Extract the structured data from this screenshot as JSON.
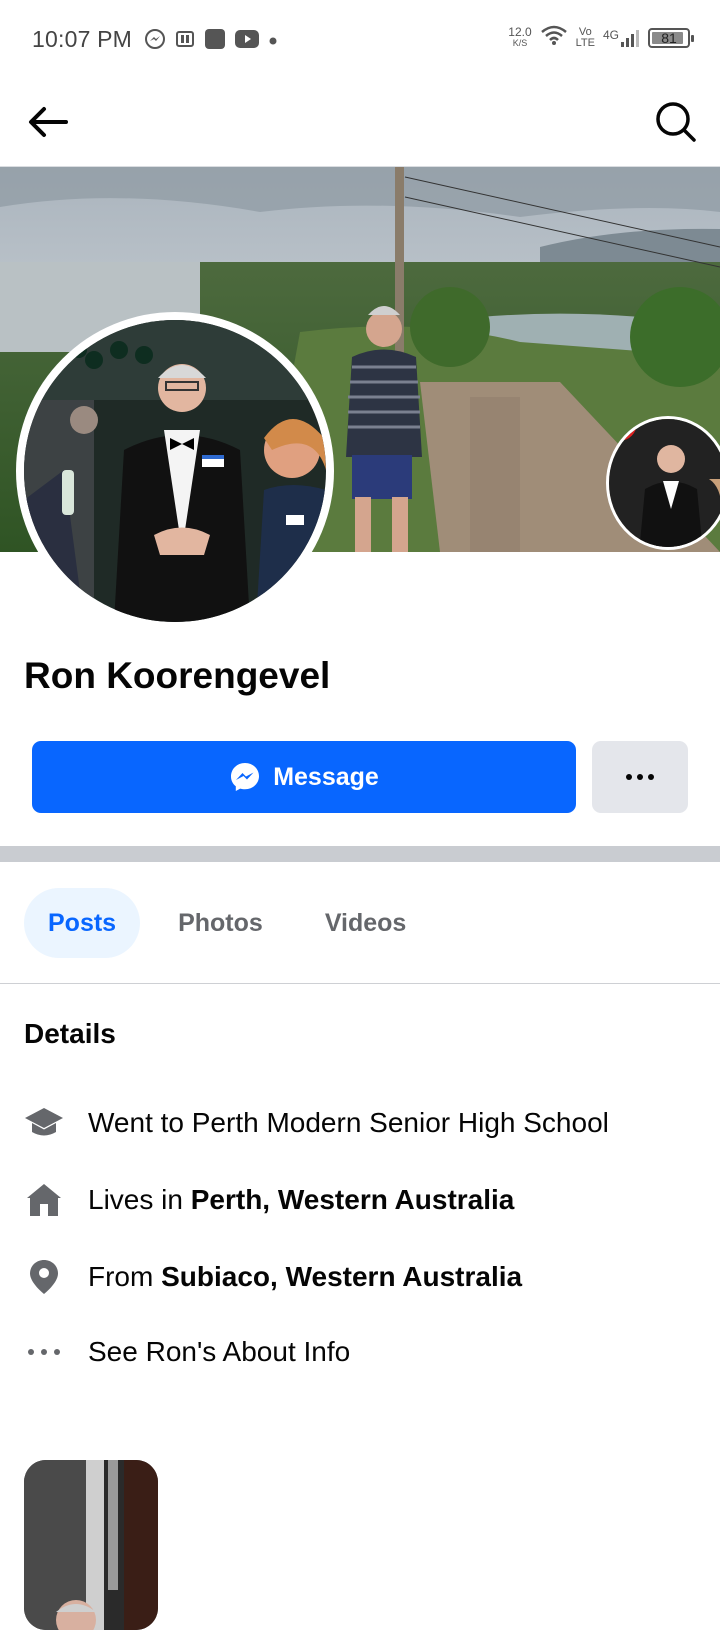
{
  "status_bar": {
    "time": "10:07 PM",
    "net_speed": "12.0",
    "net_speed_unit": "K/S",
    "volte": "Vo",
    "volte_sub": "LTE",
    "network": "4G",
    "battery": "81",
    "icons": [
      "messenger-icon",
      "news-app-icon",
      "app-icon",
      "youtube-icon",
      "dot-icon",
      "wifi-icon",
      "signal-icon",
      "battery-icon"
    ]
  },
  "nav": {
    "icons": [
      "back-arrow-icon",
      "search-icon"
    ]
  },
  "profile": {
    "name": "Ron Koorengevel",
    "message_label": "Message",
    "more_label": "···"
  },
  "tabs": [
    {
      "label": "Posts",
      "active": true
    },
    {
      "label": "Photos",
      "active": false
    },
    {
      "label": "Videos",
      "active": false
    }
  ],
  "details": {
    "title": "Details",
    "education": "Went to Perth Modern Senior High School",
    "lives_prefix": "Lives in ",
    "lives_place": "Perth, Western Australia",
    "from_prefix": "From ",
    "from_place": "Subiaco, Western Australia",
    "about": "See Ron's About Info"
  },
  "colors": {
    "accent": "#0866ff",
    "tab_active_bg": "#ebf5ff",
    "secondary_button": "#e4e6eb",
    "divider": "#c9ccd1"
  }
}
